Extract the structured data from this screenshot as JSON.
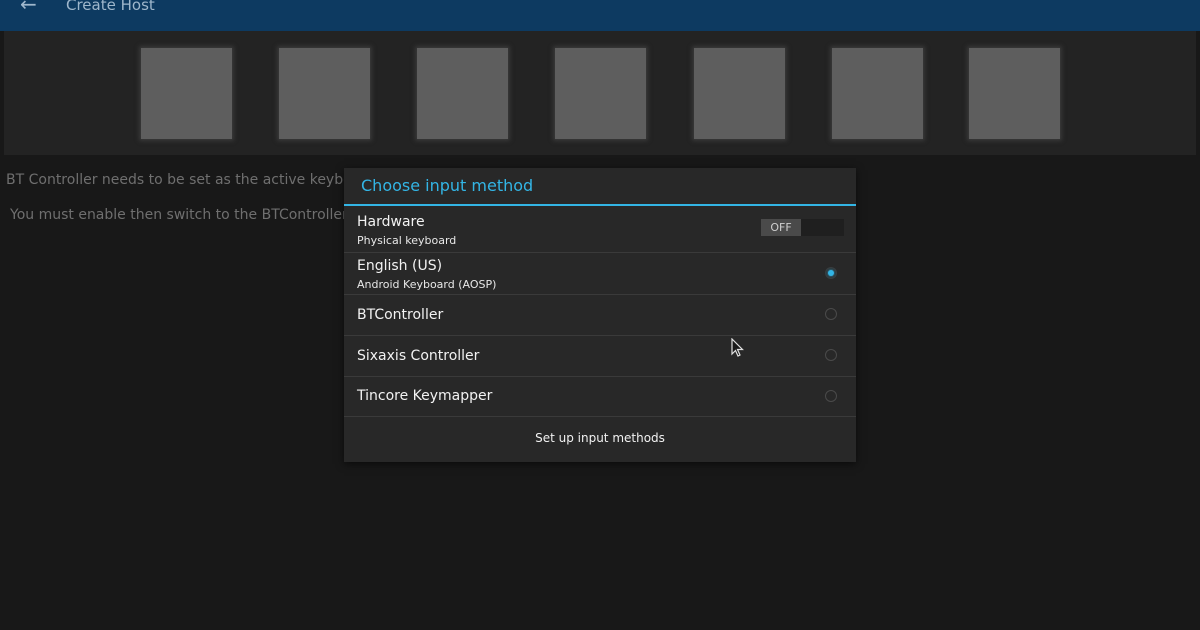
{
  "actionbar": {
    "title": "Create Host",
    "back_icon": "arrow-left-icon"
  },
  "thumbnails": {
    "count": 7
  },
  "background_text": {
    "line1": "BT Controller needs to be set as the active keyboa",
    "line2": "You must enable then switch to the BTController"
  },
  "dialog": {
    "title": "Choose input method",
    "hardware": {
      "label": "Hardware",
      "sublabel": "Physical keyboard",
      "toggle_text": "OFF"
    },
    "options": [
      {
        "label": "English (US)",
        "sublabel": "Android Keyboard (AOSP)",
        "selected": true
      },
      {
        "label": "BTController",
        "selected": false
      },
      {
        "label": "Sixaxis Controller",
        "selected": false
      },
      {
        "label": "Tincore Keymapper",
        "selected": false
      }
    ],
    "footer_button": "Set up input methods"
  },
  "colors": {
    "accent": "#33b5e5",
    "actionbar": "#0d3a61",
    "dialog_bg": "#282828"
  }
}
